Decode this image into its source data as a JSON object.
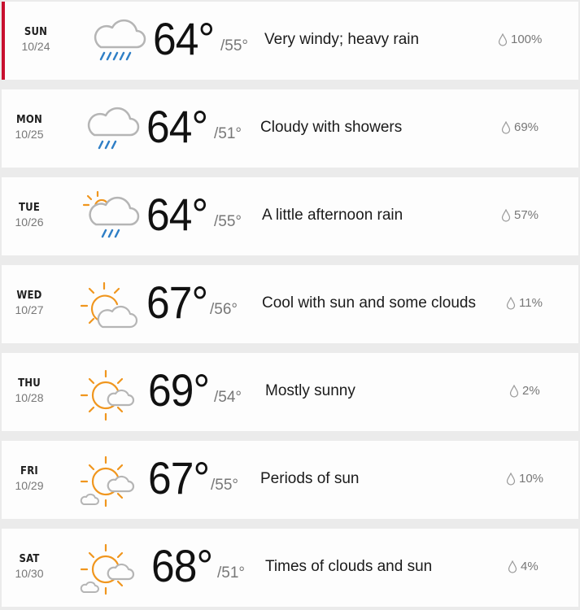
{
  "forecast": [
    {
      "dow": "SUN",
      "date": "10/24",
      "high": "64°",
      "low": "/55°",
      "description": "Very windy; heavy rain",
      "precip": "100%",
      "icon": "rain-heavy-icon",
      "active": true
    },
    {
      "dow": "MON",
      "date": "10/25",
      "high": "64°",
      "low": "/51°",
      "description": "Cloudy with showers",
      "precip": "69%",
      "icon": "cloud-rain-icon",
      "active": false
    },
    {
      "dow": "TUE",
      "date": "10/26",
      "high": "64°",
      "low": "/55°",
      "description": "A little afternoon rain",
      "precip": "57%",
      "icon": "sun-cloud-rain-icon",
      "active": false
    },
    {
      "dow": "WED",
      "date": "10/27",
      "high": "67°",
      "low": "/56°",
      "description": "Cool with sun and some clouds",
      "precip": "11%",
      "icon": "partly-sunny-icon",
      "active": false
    },
    {
      "dow": "THU",
      "date": "10/28",
      "high": "69°",
      "low": "/54°",
      "description": "Mostly sunny",
      "precip": "2%",
      "icon": "mostly-sunny-icon",
      "active": false
    },
    {
      "dow": "FRI",
      "date": "10/29",
      "high": "67°",
      "low": "/55°",
      "description": "Periods of sun",
      "precip": "10%",
      "icon": "sun-clouds-icon",
      "active": false
    },
    {
      "dow": "SAT",
      "date": "10/30",
      "high": "68°",
      "low": "/51°",
      "description": "Times of clouds and sun",
      "precip": "4%",
      "icon": "sun-clouds-icon",
      "active": false
    }
  ],
  "colors": {
    "accent": "#c8102e",
    "sun": "#f0961e",
    "rain": "#2f7fc6",
    "cloud": "#b5b5b5"
  }
}
